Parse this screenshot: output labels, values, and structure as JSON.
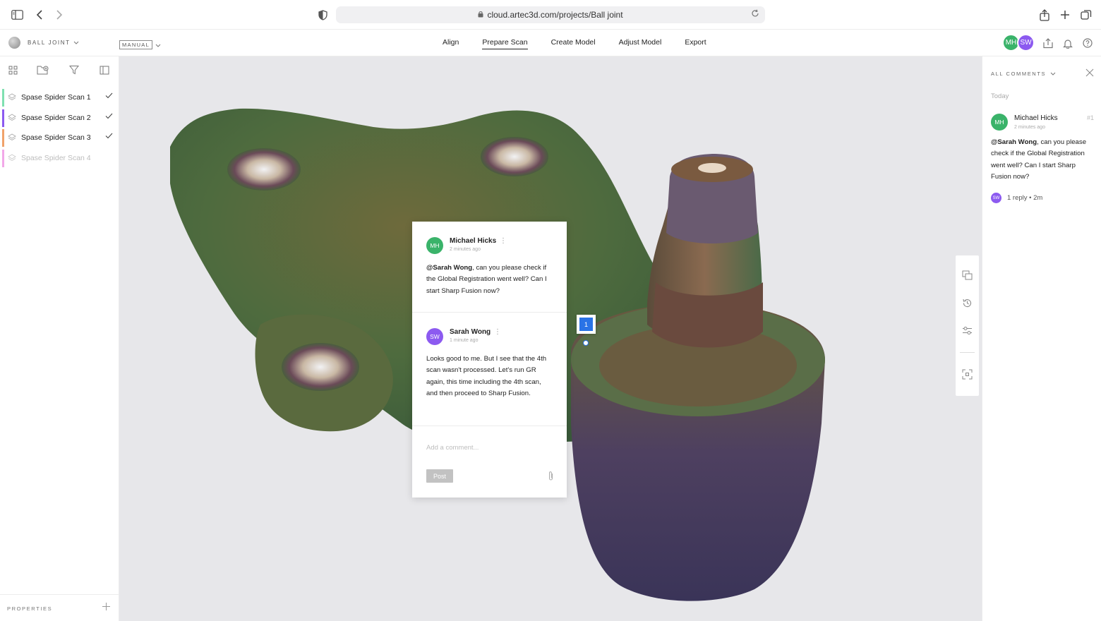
{
  "browser": {
    "url": "cloud.artec3d.com/projects/Ball joint",
    "icons": [
      "sidebar-icon",
      "back-icon",
      "forward-icon",
      "shield-icon",
      "lock-icon",
      "reload-icon",
      "share-icon",
      "new-tab-icon",
      "tabs-icon"
    ]
  },
  "header": {
    "project_name": "BALL JOINT",
    "mode": "MANUAL",
    "nav": [
      {
        "label": "Align",
        "active": false
      },
      {
        "label": "Prepare Scan",
        "active": true
      },
      {
        "label": "Create Model",
        "active": false
      },
      {
        "label": "Adjust Model",
        "active": false
      },
      {
        "label": "Export",
        "active": false
      }
    ],
    "avatars": [
      {
        "initials": "MH",
        "color": "#3ab36a"
      },
      {
        "initials": "SW",
        "color": "#8c5af0"
      }
    ]
  },
  "scans": [
    {
      "label": "Spase Spider Scan 1",
      "color": "#7fe0b0",
      "checked": true,
      "disabled": false
    },
    {
      "label": "Spase Spider Scan 2",
      "color": "#8c5af0",
      "checked": true,
      "disabled": false
    },
    {
      "label": "Spase Spider Scan 3",
      "color": "#f0a26a",
      "checked": true,
      "disabled": false
    },
    {
      "label": "Spase Spider Scan 4",
      "color": "#f2a8e8",
      "checked": false,
      "disabled": true
    }
  ],
  "properties_label": "PROPERTIES",
  "comment_card": {
    "thread": [
      {
        "initials": "MH",
        "color": "#3ab36a",
        "name": "Michael Hicks",
        "time": "2 minutes ago",
        "mention": "@Sarah Wong",
        "text": ", can you please check if the Global Registration went well? Can I start Sharp Fusion now?"
      },
      {
        "initials": "SW",
        "color": "#8c5af0",
        "name": "Sarah Wong",
        "time": "1 minute ago",
        "mention": "",
        "text": "Looks good to me. But I see that the 4th scan wasn't processed. Let's run GR again, this time including the 4th scan, and then proceed to Sharp Fusion."
      }
    ],
    "input_placeholder": "Add a comment...",
    "post_label": "Post"
  },
  "pin_number": "1",
  "right_panel": {
    "title": "ALL COMMENTS",
    "group": "Today",
    "comment": {
      "initials": "MH",
      "name": "Michael Hicks",
      "number": "#1",
      "time": "2 minutes ago",
      "mention": "@Sarah Wong",
      "text": ", can you please check if the Global Registration went well? Can I start Sharp Fusion now?"
    },
    "reply_initials": "SW",
    "reply_summary": "1 reply • 2m"
  }
}
